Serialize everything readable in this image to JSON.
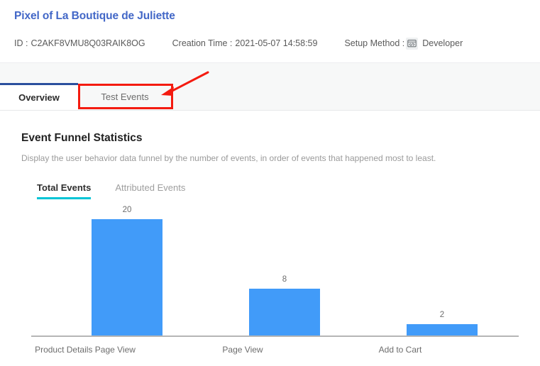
{
  "header": {
    "title": "Pixel of La Boutique de Juliette",
    "meta": {
      "id_label": "ID :",
      "id_value": "C2AKF8VMU8Q03RAIK8OG",
      "creation_label": "Creation Time :",
      "creation_value": "2021-05-07 14:58:59",
      "setup_label": "Setup Method :",
      "setup_icon": "code-icon",
      "setup_value": "Developer"
    }
  },
  "tabs": {
    "items": [
      {
        "label": "Overview",
        "active": true
      },
      {
        "label": "Test Events",
        "active": false
      }
    ]
  },
  "annotation": {
    "highlight_target": "Test Events",
    "box_color": "#f41b10",
    "arrow_color": "#f41b10"
  },
  "main": {
    "section_title": "Event Funnel Statistics",
    "section_description": "Display the user behavior data funnel by the number of events, in order of events that happened most to least.",
    "subtabs": [
      {
        "label": "Total Events",
        "active": true
      },
      {
        "label": "Attributed Events",
        "active": false
      }
    ]
  },
  "chart_data": {
    "type": "bar",
    "title": "Event Funnel Statistics",
    "subtitle": "Display the user behavior data funnel by the number of events, in order of events that happened most to least.",
    "categories": [
      "Product Details Page View",
      "Page View",
      "Add to Cart"
    ],
    "values": [
      20,
      8,
      2
    ],
    "value_labels": [
      "20",
      "8",
      "2"
    ],
    "series": [
      {
        "name": "Total Events",
        "values": [
          20,
          8,
          2
        ]
      }
    ],
    "xlabel": "",
    "ylabel": "",
    "ylim": [
      0,
      20
    ],
    "grid": false,
    "legend": false,
    "bar_color": "#419bf9",
    "axis_color": "#b6b6b6",
    "label_color": "#6d6d6d"
  },
  "colors": {
    "title_blue": "#4267c7",
    "tab_active_border": "#2b4f9e",
    "subtab_accent": "#00c4d6",
    "bar_blue": "#419bf9",
    "annotation_red": "#f41b10"
  }
}
